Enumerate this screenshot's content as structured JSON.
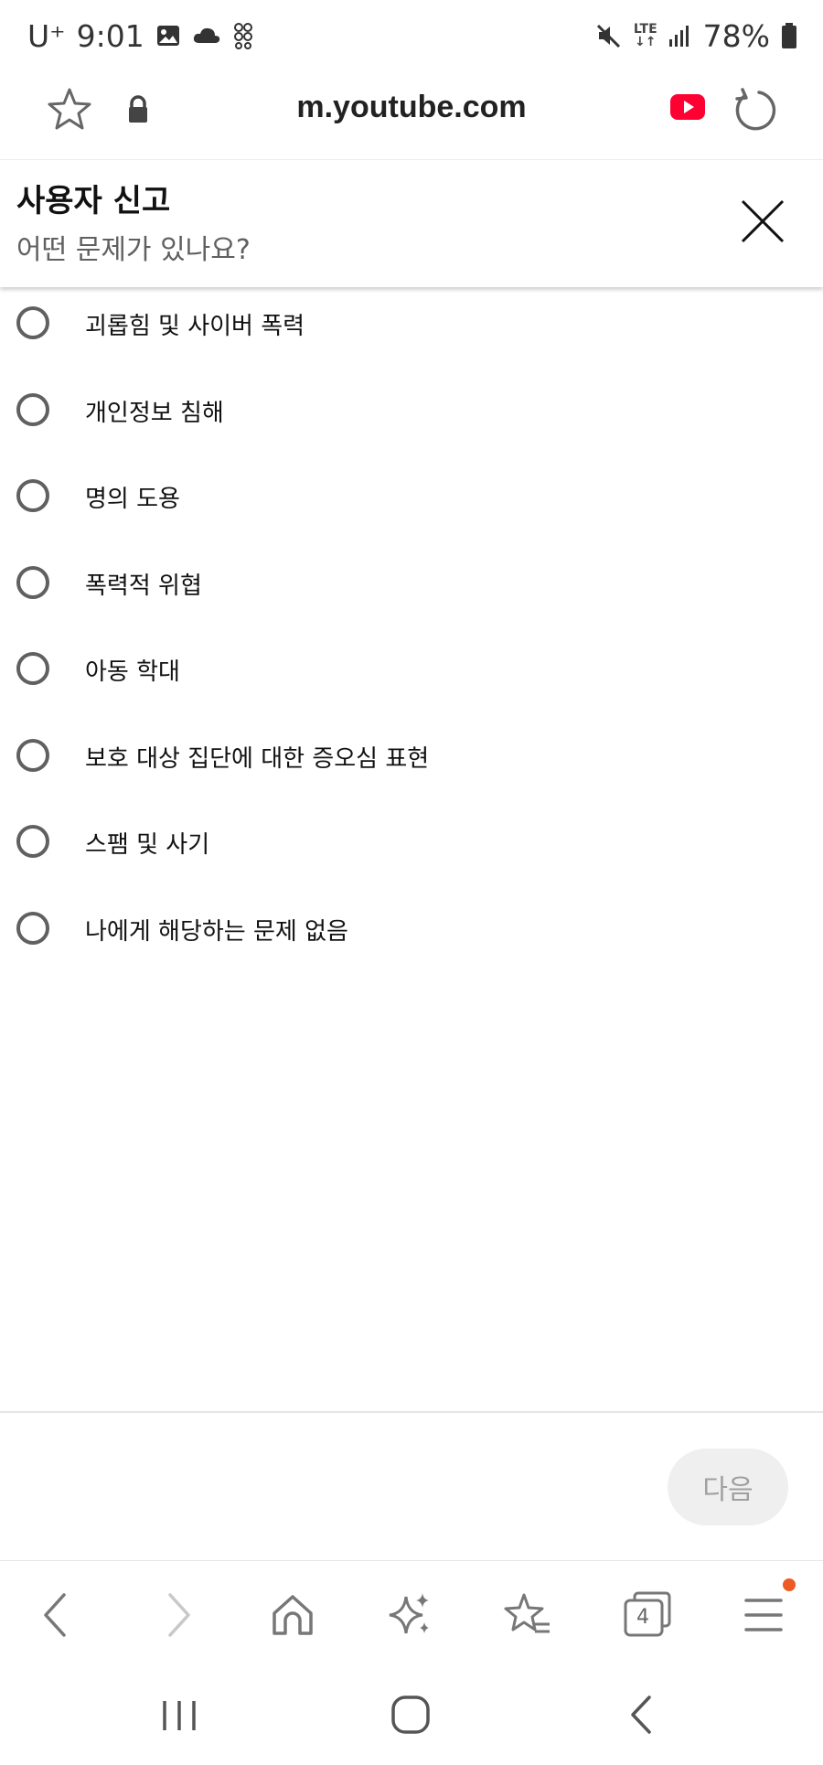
{
  "status_bar": {
    "carrier": "U⁺",
    "time": "9:01",
    "network": "LTE",
    "battery": "78%"
  },
  "browser": {
    "url": "m.youtube.com",
    "tab_count": "4"
  },
  "report": {
    "title": "사용자 신고",
    "subtitle": "어떤 문제가 있나요?",
    "options": [
      {
        "label": "괴롭힘 및 사이버 폭력",
        "selected": false
      },
      {
        "label": "개인정보 침해",
        "selected": false
      },
      {
        "label": "명의 도용",
        "selected": false
      },
      {
        "label": "폭력적 위협",
        "selected": false
      },
      {
        "label": "아동 학대",
        "selected": false
      },
      {
        "label": "보호 대상 집단에 대한 증오심 표현",
        "selected": false
      },
      {
        "label": "스팸 및 사기",
        "selected": false
      },
      {
        "label": "나에게 해당하는 문제 없음",
        "selected": false
      }
    ],
    "next_label": "다음"
  },
  "colors": {
    "youtube_red": "#ff0033",
    "notification_dot": "#ee5a24",
    "radio_border": "#606060"
  },
  "icons": {
    "status": [
      "gallery-icon",
      "cloud-icon",
      "app-icon",
      "mute-icon",
      "signal-icon",
      "battery-icon"
    ],
    "url_bar": [
      "bookmark-star-icon",
      "lock-icon",
      "youtube-icon",
      "reload-icon"
    ],
    "toolbar": [
      "back-icon",
      "forward-icon",
      "home-icon",
      "sparkle-icon",
      "bookmarks-icon",
      "tabs-icon",
      "menu-icon"
    ],
    "navbar": [
      "recent-apps-icon",
      "home-circle-icon",
      "nav-back-icon"
    ]
  }
}
